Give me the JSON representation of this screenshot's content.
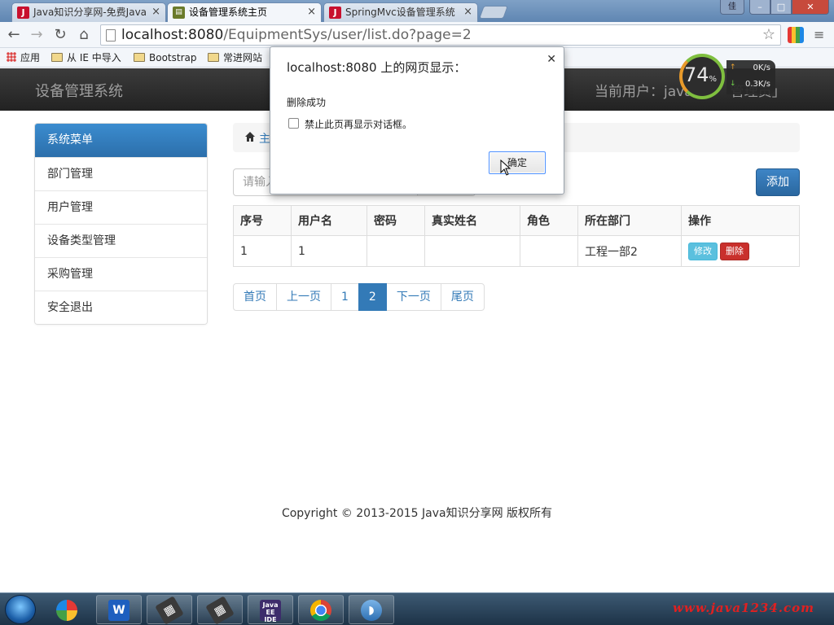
{
  "browser": {
    "tabs": [
      {
        "title": "Java知识分享网-免费Java",
        "favicon": "J"
      },
      {
        "title": "设备管理系统主页",
        "favicon": "sys"
      },
      {
        "title": "SpringMvc设备管理系统",
        "favicon": "J"
      }
    ],
    "url_host": "localhost:8080",
    "url_path": "/EquipmentSys/user/list.do?page=2",
    "bookmarks": [
      "应用",
      "从 IE 中导入",
      "Bootstrap",
      "常进网站"
    ],
    "window_user_label": "佳"
  },
  "speed_widget": {
    "percent": "74",
    "percent_unit": "%",
    "up": "0K/s",
    "down": "0.3K/s"
  },
  "app": {
    "brand": "设备管理系统",
    "current_user": "当前用户：java",
    "current_user_tail": "管理员」",
    "sidebar": {
      "header": "系统菜单",
      "items": [
        "部门管理",
        "用户管理",
        "设备类型管理",
        "采购管理",
        "安全退出"
      ]
    },
    "breadcrumb": "主",
    "search_placeholder": "请输入",
    "add_label": "添加",
    "table": {
      "headers": [
        "序号",
        "用户名",
        "密码",
        "真实姓名",
        "角色",
        "所在部门",
        "操作"
      ],
      "rows": [
        {
          "id": "1",
          "username": "1",
          "password": "",
          "realname": "",
          "role": "",
          "dept": "工程一部2"
        }
      ],
      "edit_label": "修改",
      "delete_label": "删除"
    },
    "pagination": [
      "首页",
      "上一页",
      "1",
      "2",
      "下一页",
      "尾页"
    ],
    "pagination_active": "2",
    "footer": "Copyright © 2013-2015 Java知识分享网 版权所有"
  },
  "dialog": {
    "title": "localhost:8080 上的网页显示：",
    "message": "删除成功",
    "checkbox_label": "禁止此页再显示对话框。",
    "ok_label": "确定"
  },
  "taskbar": {
    "apps": [
      "wps-writer",
      "ide-1",
      "ide-2",
      "java-ee-ide",
      "chrome",
      "dolphin"
    ],
    "java_ee_label": "Java EE IDE",
    "watermark": "www.java1234.com"
  }
}
